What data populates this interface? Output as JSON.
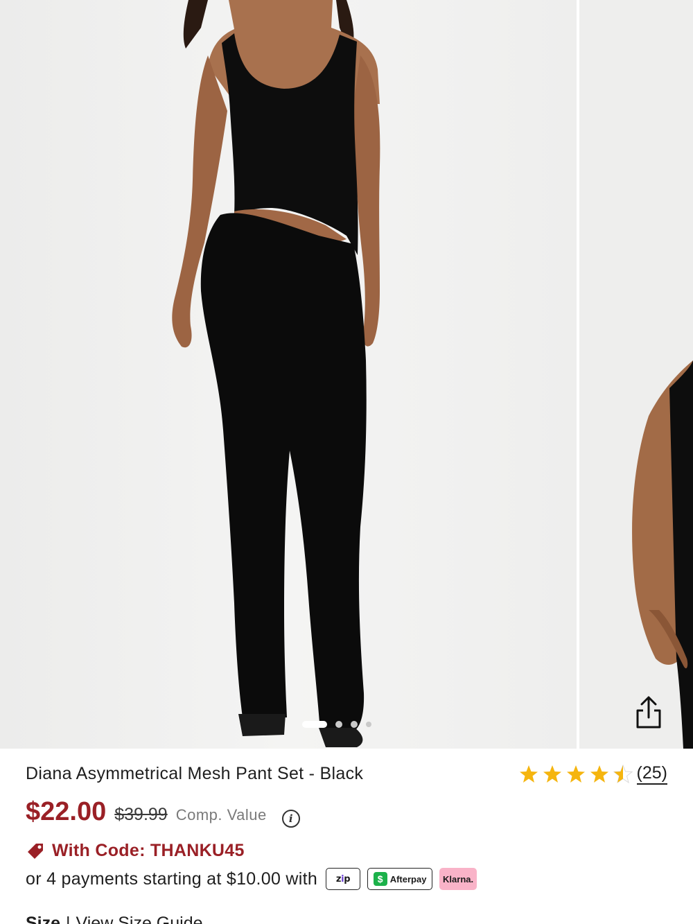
{
  "gallery": {
    "total_images": 4,
    "active_index": 0,
    "share_icon": "share-icon"
  },
  "product": {
    "title": "Diana Asymmetrical Mesh Pant Set - Black",
    "rating": {
      "stars": 4.5,
      "max_stars": 5,
      "count_label": "(25)",
      "star_color": "#f5b50f"
    },
    "price": {
      "current": "$22.00",
      "original": "$39.99",
      "comp_label": "Comp. Value",
      "sale_color": "#9a2026"
    },
    "promo": {
      "icon": "tag-icon",
      "text": "With Code: THANKU45"
    },
    "payments": {
      "text": "or 4 payments starting at $10.00 with",
      "zip_label_a": "z",
      "zip_label_b": "i",
      "zip_label_c": "p",
      "afterpay_label": "Afterpay",
      "afterpay_symbol": "$",
      "klarna_label": "Klarna."
    },
    "size": {
      "label": "Size",
      "separator": "|",
      "guide_link": "View Size Guide"
    }
  }
}
